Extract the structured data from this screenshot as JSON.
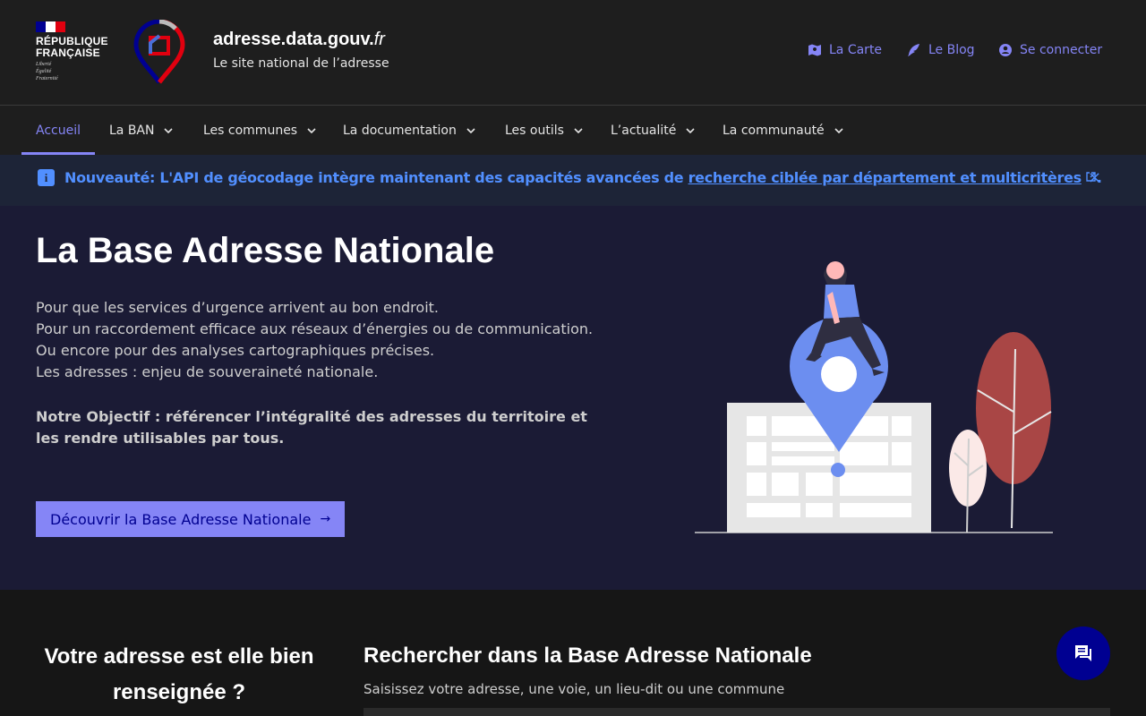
{
  "header": {
    "rf_name_line1": "RÉPUBLIQUE",
    "rf_name_line2": "FRANÇAISE",
    "rf_motto_1": "Liberté",
    "rf_motto_2": "Égalité",
    "rf_motto_3": "Fraternité",
    "site_name": "adresse.data.gouv.",
    "site_tld": "fr",
    "tagline": "Le site national de l’adresse",
    "quick_links": [
      {
        "label": "La Carte",
        "icon": "map-icon"
      },
      {
        "label": "Le Blog",
        "icon": "feather-icon"
      },
      {
        "label": "Se connecter",
        "icon": "account-icon"
      }
    ]
  },
  "nav": {
    "items": [
      {
        "label": "Accueil",
        "active": true
      },
      {
        "label": "La BAN"
      },
      {
        "label": "Les communes"
      },
      {
        "label": "La documentation"
      },
      {
        "label": "Les outils"
      },
      {
        "label": "L’actualité"
      },
      {
        "label": "La communauté"
      }
    ]
  },
  "notice": {
    "text_prefix": "Nouveauté: L'API de géocodage intègre maintenant des capacités avancées de ",
    "link_text": "recherche ciblée par département et multicritères",
    "text_suffix": ".",
    "close_label": "×"
  },
  "hero": {
    "title": "La Base Adresse Nationale",
    "lines": [
      "Pour que les services d’urgence arrivent au bon endroit.",
      "Pour un raccordement efficace aux réseaux d’énergies ou de communication.",
      "Ou encore pour des analyses cartographiques précises.",
      "Les adresses : enjeu de souveraineté nationale."
    ],
    "goal": "Notre Objectif : référencer l’intégralité des adresses du territoire et les rendre utilisables par tous.",
    "cta": "Découvrir la Base Adresse Nationale",
    "cta_arrow": "→"
  },
  "bottom": {
    "left_title": "Votre adresse est elle bien renseignée ?",
    "search_title": "Rechercher dans la Base Adresse Nationale",
    "search_hint": "Saisissez votre adresse, une voie, un lieu-dit ou une commune"
  },
  "colors": {
    "accent": "#8585f6",
    "info_blue": "#518fff",
    "hero_bg": "#1b1b35",
    "tree_red": "#a94645",
    "tree_pink": "#fbe9e7",
    "pin_blue": "#6c8ef0",
    "chat_bg": "#000091"
  }
}
